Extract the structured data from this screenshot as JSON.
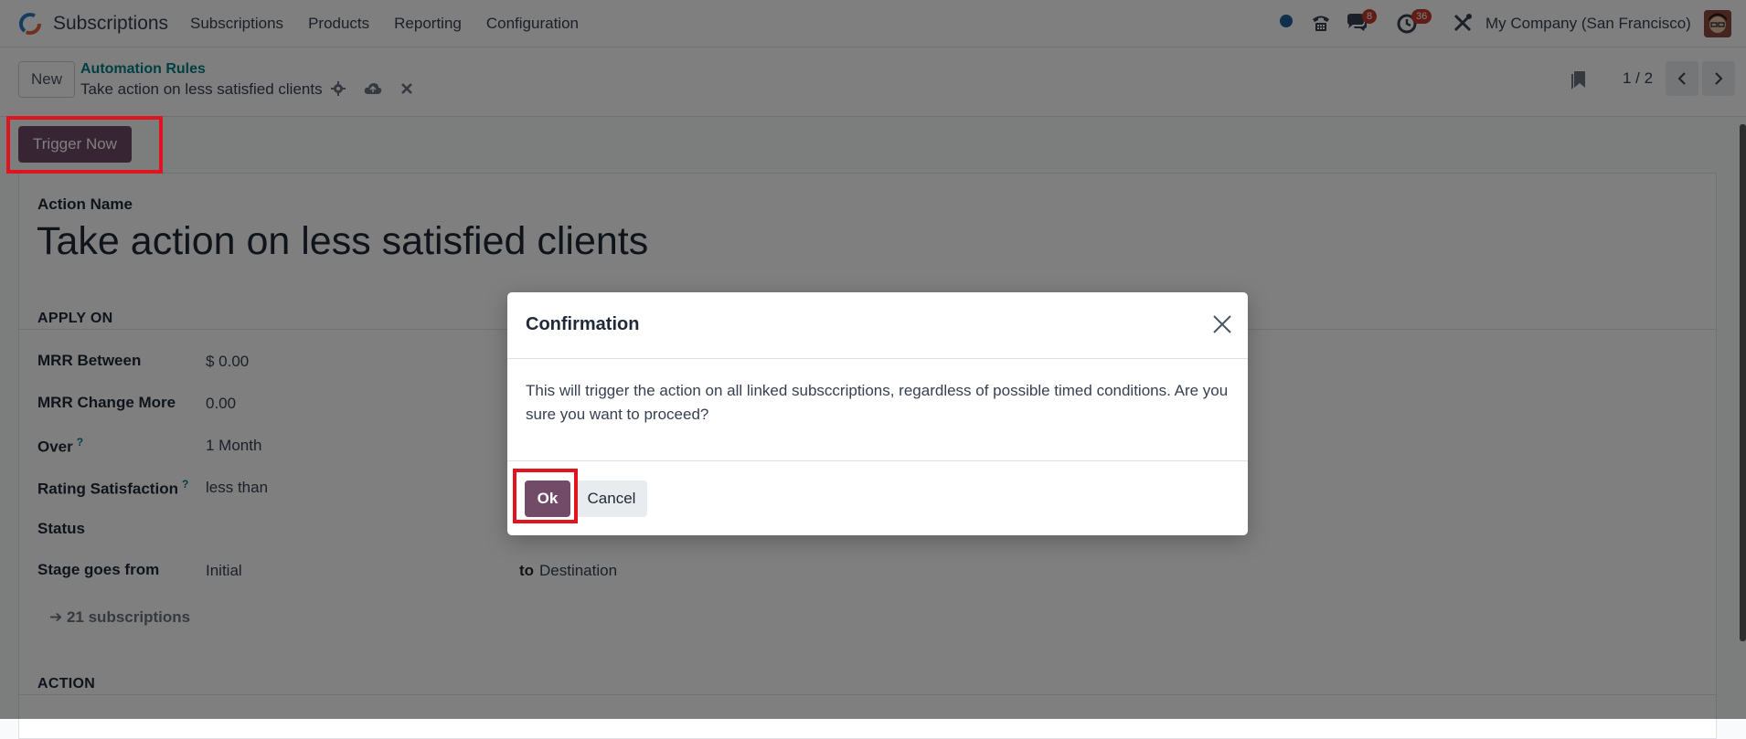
{
  "navbar": {
    "app_name": "Subscriptions",
    "menu": [
      "Subscriptions",
      "Products",
      "Reporting",
      "Configuration"
    ],
    "messages_count": "8",
    "activities_count": "36",
    "company": "My Company (San Francisco)"
  },
  "control_panel": {
    "new_label": "New",
    "breadcrumb_parent": "Automation Rules",
    "breadcrumb_current": "Take action on less satisfied clients",
    "pager": "1 / 2"
  },
  "status_bar": {
    "trigger_label": "Trigger Now"
  },
  "form": {
    "action_name_label": "Action Name",
    "action_name": "Take action on less satisfied clients",
    "apply_on_title": "APPLY ON",
    "fields": [
      {
        "label": "MRR Between",
        "value": "$ 0.00"
      },
      {
        "label": "MRR Change More",
        "value": "0.00"
      },
      {
        "label": "Over",
        "value": "1 Month"
      },
      {
        "label": "Rating Satisfaction",
        "value": "less than"
      },
      {
        "label": "Status",
        "value": ""
      },
      {
        "label": "Stage goes from",
        "value": "Initial"
      }
    ],
    "help_mark": "?",
    "to_label": "to",
    "to_value": "Destination",
    "subscriptions_link": "21 subscriptions",
    "action_title": "ACTION"
  },
  "dialog": {
    "title": "Confirmation",
    "body": "This will trigger the action on all linked subsccriptions, regardless of possible timed conditions. Are you sure you want to proceed?",
    "ok_label": "Ok",
    "cancel_label": "Cancel"
  },
  "colors": {
    "brand": "#714b67",
    "link": "#017e84",
    "badge": "#c0392b",
    "highlight": "#e0141e"
  }
}
